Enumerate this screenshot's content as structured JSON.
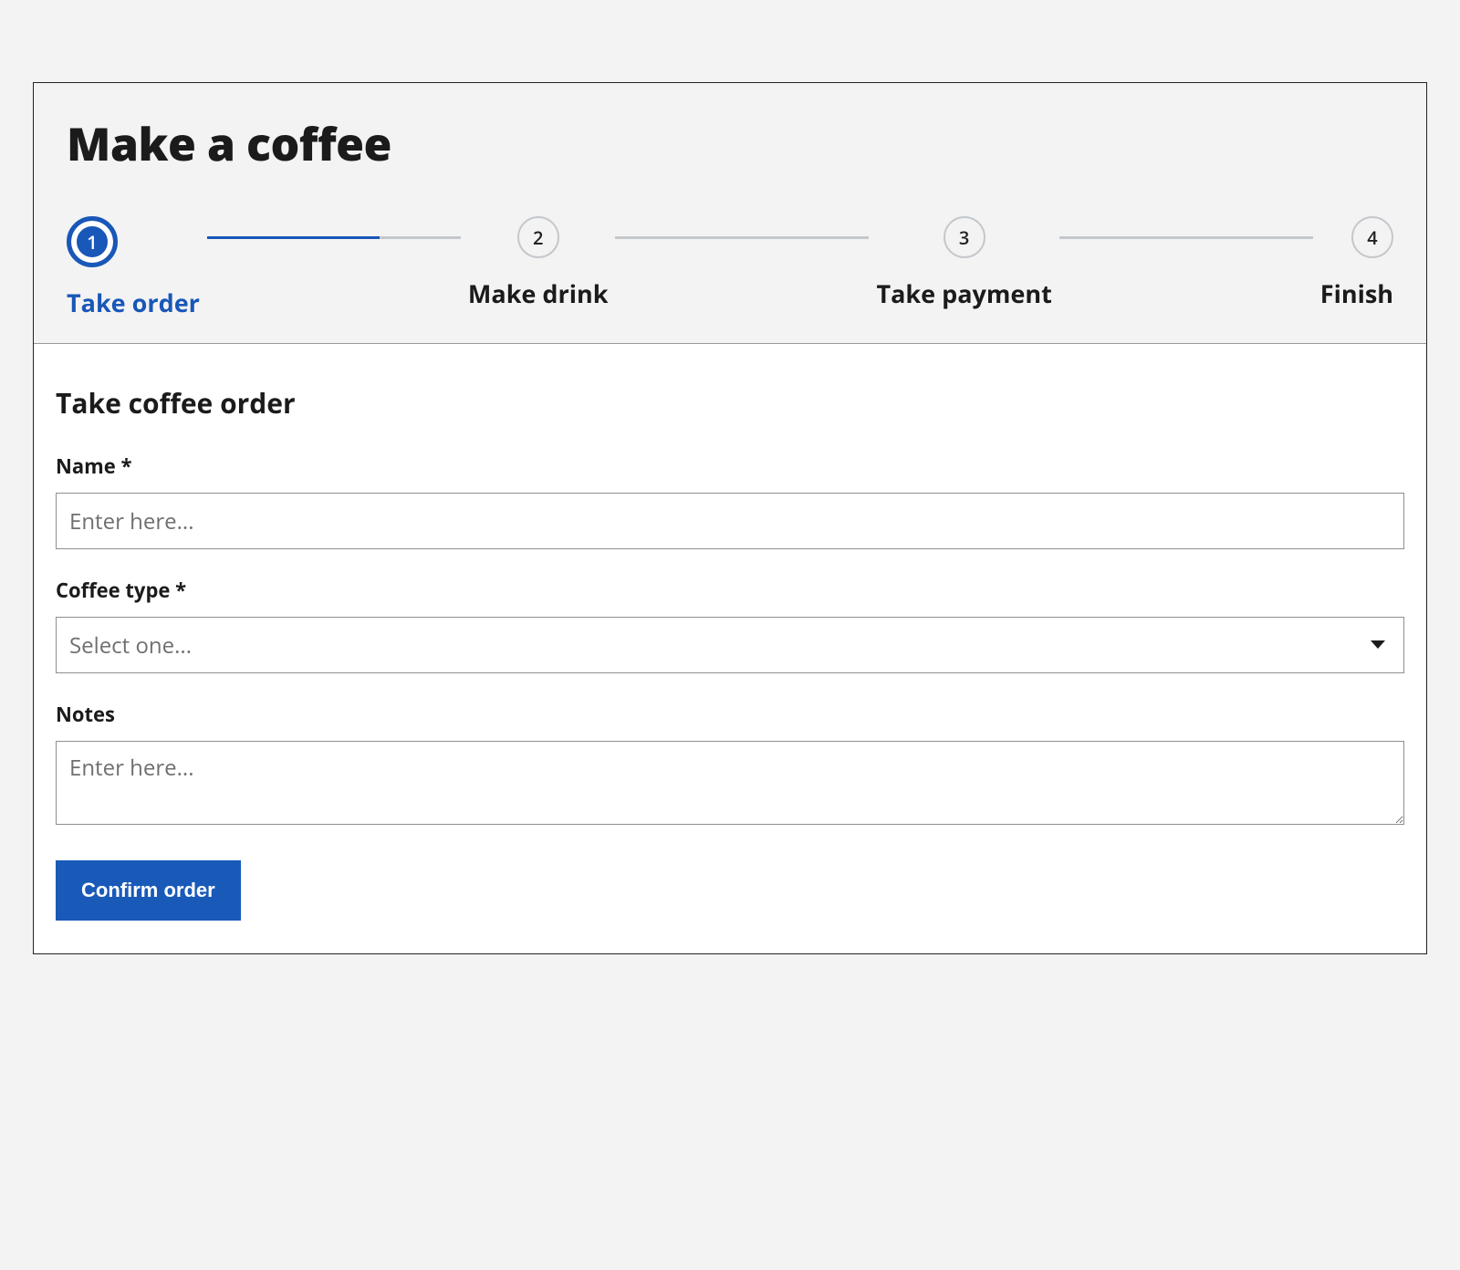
{
  "title": "Make a coffee",
  "stepper": {
    "steps": [
      {
        "num": "1",
        "label": "Take order",
        "active": true
      },
      {
        "num": "2",
        "label": "Make drink",
        "active": false
      },
      {
        "num": "3",
        "label": "Take payment",
        "active": false
      },
      {
        "num": "4",
        "label": "Finish",
        "active": false
      }
    ]
  },
  "form": {
    "section_title": "Take coffee order",
    "name": {
      "label": "Name *",
      "placeholder": "Enter here...",
      "value": ""
    },
    "type": {
      "label": "Coffee type *",
      "placeholder": "Select one..."
    },
    "notes": {
      "label": "Notes",
      "placeholder": "Enter here...",
      "value": ""
    },
    "submit_label": "Confirm order"
  },
  "colors": {
    "primary": "#195ab9",
    "border": "#8f8f8f",
    "muted": "#c4c8cc"
  }
}
